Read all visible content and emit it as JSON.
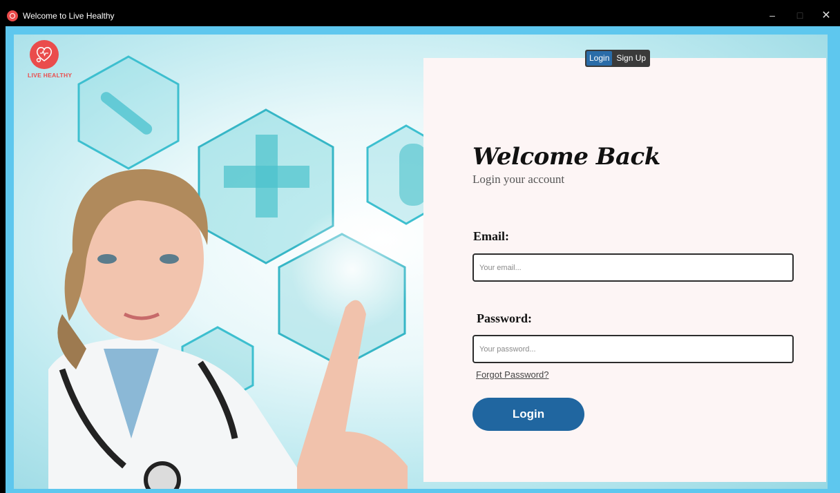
{
  "window": {
    "title": "Welcome to Live Healthy",
    "minimize": "–",
    "maximize": "□",
    "close": "✕"
  },
  "brand": {
    "logo_text": "LIVE HEALTHY",
    "accent": "#ea4c4c"
  },
  "tabs": [
    {
      "label": "Login",
      "active": true
    },
    {
      "label": "Sign Up",
      "active": false
    }
  ],
  "form": {
    "heading": "Welcome Back",
    "subheading": "Login your account",
    "email_label": "Email:",
    "email_placeholder": "Your email...",
    "password_label": "Password:",
    "password_placeholder": "Your password...",
    "forgot_link": "Forgot Password?",
    "submit_label": "Login"
  },
  "colors": {
    "frame": "#5ec7ee",
    "panel_bg": "#fdf5f5",
    "button": "#2066a0",
    "active_tab": "#2a6ca8"
  }
}
